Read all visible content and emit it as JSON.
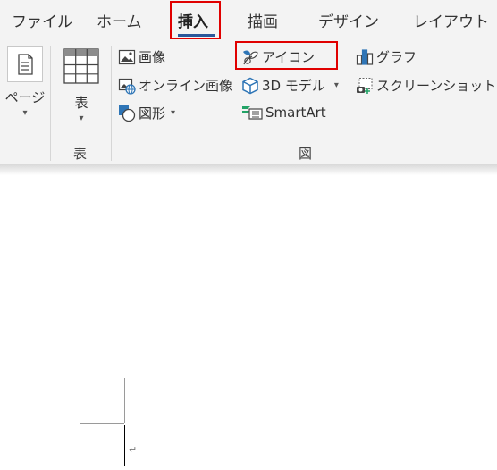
{
  "tabs": {
    "file": "ファイル",
    "home": "ホーム",
    "insert": "挿入",
    "draw": "描画",
    "design": "デザイン",
    "layout": "レイアウト"
  },
  "ribbon": {
    "pages_label": "ページ",
    "table_button_label": "表",
    "table_group_label": "表",
    "illustrations_group_label": "図",
    "picture_label": "画像",
    "online_picture_label": "オンライン画像",
    "shapes_label": "図形",
    "icons_label": "アイコン",
    "model3d_label": "3D モデル",
    "smartart_label": "SmartArt",
    "chart_label": "グラフ",
    "screenshot_label": "スクリーンショット"
  },
  "document": {
    "paragraph_mark": "↵"
  },
  "colors": {
    "highlight": "#e00000",
    "active_tab_underline": "#2b579a",
    "ribbon_bg": "#f3f3f3",
    "icon_blue": "#2e75b6",
    "icon_green": "#21a366"
  }
}
